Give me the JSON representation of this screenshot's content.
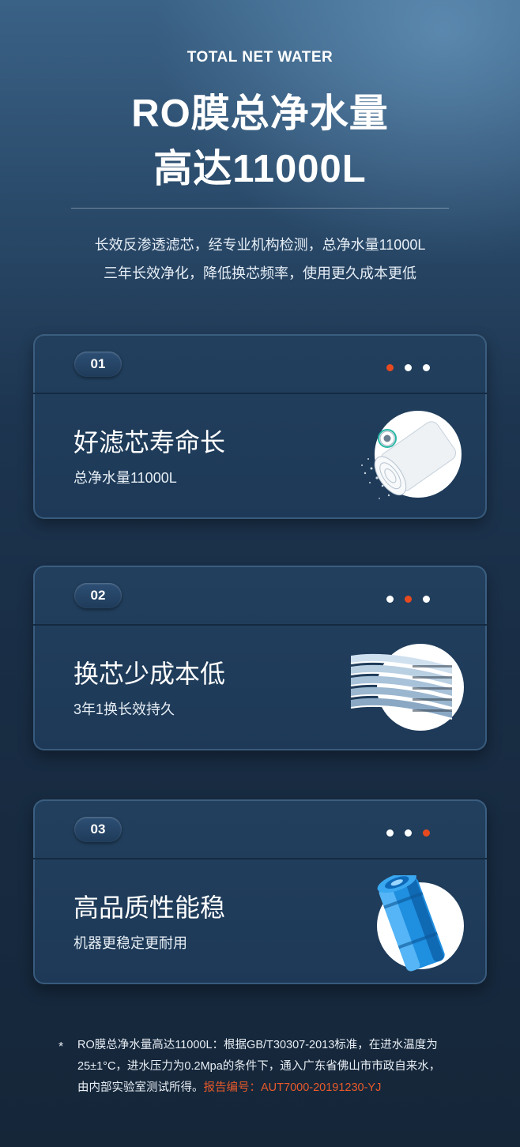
{
  "header": {
    "kicker": "TOTAL NET WATER",
    "title_line1": "RO膜总净水量",
    "title_line2": "高达11000L",
    "desc_line1": "长效反渗透滤芯，经专业机构检测，总净水量11000L",
    "desc_line2": "三年长效净化，降低换芯频率，使用更久成本更低"
  },
  "cards": [
    {
      "number": "01",
      "title": "好滤芯寿命长",
      "subtitle": "总净水量11000L",
      "active_dot": 1,
      "icon": "filter-cartridge-splash-icon"
    },
    {
      "number": "02",
      "title": "换芯少成本低",
      "subtitle": "3年1换长效持久",
      "active_dot": 2,
      "icon": "membrane-layers-icon"
    },
    {
      "number": "03",
      "title": "高品质性能稳",
      "subtitle": "机器更稳定更耐用",
      "active_dot": 3,
      "icon": "blue-filter-housing-icon"
    }
  ],
  "footnote": {
    "star": "*",
    "line1": "RO膜总净水量高达11000L：根据GB/T30307-2013标准，在进水温度为",
    "line2": "25±1°C，进水压力为0.2Mpa的条件下，通入广东省佛山市市政自来水，",
    "line3_plain": "由内部实验室测试所得。",
    "line3_accent": "报告编号：AUT7000-20191230-YJ"
  },
  "colors": {
    "accent": "#e84a1f",
    "card_bg": "#1f3b5a",
    "page_bg": "#182c43"
  }
}
